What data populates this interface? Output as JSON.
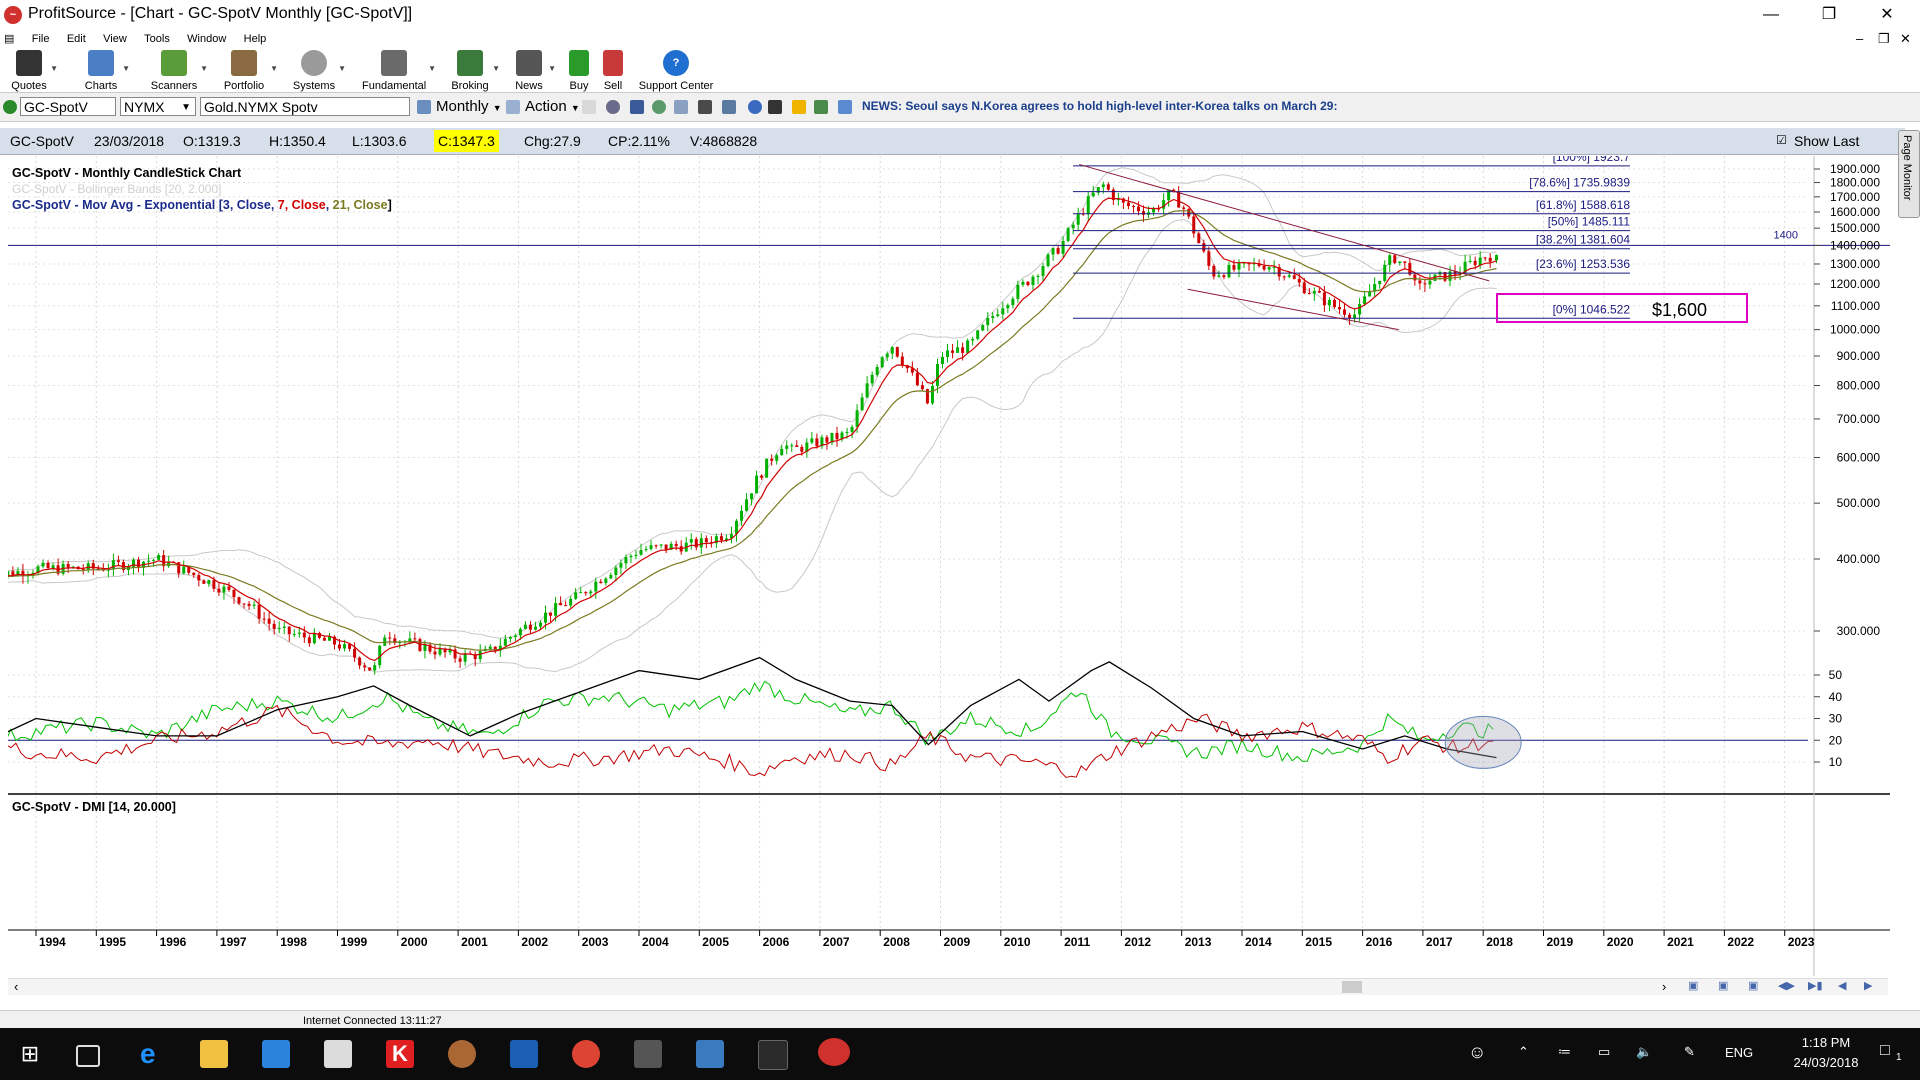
{
  "window": {
    "title": "ProfitSource - [Chart - GC-SpotV Monthly [GC-SpotV]]"
  },
  "menu": [
    "File",
    "Edit",
    "View",
    "Tools",
    "Window",
    "Help"
  ],
  "toolbar": {
    "items": [
      "Quotes",
      "Charts",
      "Scanners",
      "Portfolio",
      "Systems",
      "Fundamental",
      "Broking",
      "News",
      "Buy",
      "Sell",
      "Support Center"
    ]
  },
  "symbol_bar": {
    "symbol": "GC-SpotV",
    "exchange": "NYMX",
    "name": "Gold.NYMX Spotv",
    "period": "Monthly",
    "action": "Action",
    "news": "NEWS: Seoul says N.Korea agrees to hold high-level inter-Korea talks on March 29:"
  },
  "info": {
    "symbol": "GC-SpotV",
    "date": "23/03/2018",
    "open": "O:1319.3",
    "high": "H:1350.4",
    "low": "L:1303.6",
    "close": "C:1347.3",
    "chg": "Chg:27.9",
    "cp": "CP:2.11%",
    "vol": "V:4868828",
    "show_last": "Show Last"
  },
  "side_tab": "Page Monitor",
  "status": {
    "text": "Internet Connected 13:11:27"
  },
  "taskbar": {
    "lang": "ENG",
    "time": "1:18 PM",
    "date": "24/03/2018",
    "notif": "1"
  },
  "colors": {
    "bull": "#00b000",
    "bear": "#d00000",
    "ema3": "#d00000",
    "ema21": "#7a7a22",
    "bollinger": "#c8c8c8",
    "fib": "#1a1a80",
    "trend": "#8b1a3a",
    "plus_di": "#00c000",
    "minus_di": "#c00000",
    "adx": "#000000",
    "highlight": "#ffff00",
    "box": "#e000c0"
  },
  "chart_data": [
    {
      "type": "candlestick",
      "title": "GC-SpotV - Monthly CandleStick Chart",
      "legend": [
        "GC-SpotV - Bollinger Bands [20, 2.000]",
        "GC-SpotV - Mov Avg - Exponential [3, Close, 7, Close, 21, Close]"
      ],
      "ylim": [
        250,
        1960
      ],
      "y_ticks": [
        "300.000",
        "400.000",
        "500.000",
        "600.000",
        "700.000",
        "800.000",
        "900.000",
        "1000.000",
        "1100.000",
        "1200.000",
        "1300.000",
        "1400.000",
        "1500.000",
        "1600.000",
        "1700.000",
        "1800.000",
        "1900.000"
      ],
      "x_ticks": [
        "1994",
        "1995",
        "1996",
        "1997",
        "1998",
        "1999",
        "2000",
        "2001",
        "2002",
        "2003",
        "2004",
        "2005",
        "2006",
        "2007",
        "2008",
        "2009",
        "2010",
        "2011",
        "2012",
        "2013",
        "2014",
        "2015",
        "2016",
        "2017",
        "2018",
        "2019",
        "2020",
        "2021",
        "2022",
        "2023"
      ],
      "close_path": [
        [
          1993.0,
          370
        ],
        [
          1994.0,
          385
        ],
        [
          1995.0,
          385
        ],
        [
          1996.0,
          400
        ],
        [
          1996.5,
          380
        ],
        [
          1997.0,
          360
        ],
        [
          1997.5,
          335
        ],
        [
          1998.0,
          300
        ],
        [
          1999.0,
          285
        ],
        [
          1999.6,
          255
        ],
        [
          1999.8,
          300
        ],
        [
          2000.0,
          290
        ],
        [
          2001.0,
          270
        ],
        [
          2001.5,
          275
        ],
        [
          2002.0,
          300
        ],
        [
          2003.0,
          345
        ],
        [
          2004.0,
          415
        ],
        [
          2005.0,
          425
        ],
        [
          2005.5,
          445
        ],
        [
          2006.0,
          560
        ],
        [
          2006.4,
          640
        ],
        [
          2006.5,
          615
        ],
        [
          2007.0,
          640
        ],
        [
          2007.5,
          660
        ],
        [
          2008.0,
          900
        ],
        [
          2008.2,
          940
        ],
        [
          2008.8,
          740
        ],
        [
          2009.0,
          900
        ],
        [
          2009.5,
          940
        ],
        [
          2010.0,
          1100
        ],
        [
          2010.5,
          1230
        ],
        [
          2011.0,
          1400
        ],
        [
          2011.5,
          1700
        ],
        [
          2011.7,
          1780
        ],
        [
          2012.0,
          1650
        ],
        [
          2012.5,
          1600
        ],
        [
          2012.8,
          1720
        ],
        [
          2013.0,
          1650
        ],
        [
          2013.3,
          1400
        ],
        [
          2013.5,
          1250
        ],
        [
          2014.0,
          1280
        ],
        [
          2014.3,
          1300
        ],
        [
          2014.5,
          1290
        ],
        [
          2015.0,
          1190
        ],
        [
          2015.5,
          1100
        ],
        [
          2015.9,
          1060
        ],
        [
          2016.0,
          1110
        ],
        [
          2016.5,
          1340
        ],
        [
          2016.8,
          1270
        ],
        [
          2016.9,
          1150
        ],
        [
          2017.0,
          1210
        ],
        [
          2017.5,
          1250
        ],
        [
          2018.0,
          1340
        ],
        [
          2018.22,
          1347.3
        ]
      ],
      "current_bar": {
        "open": 1319.3,
        "high": 1350.4,
        "low": 1303.6,
        "close": 1347.3
      },
      "fib_levels": [
        {
          "label": "[100%] 1923.7",
          "value": 1923.7
        },
        {
          "label": "[78.6%] 1735.9839",
          "value": 1735.9839
        },
        {
          "label": "[61.8%] 1588.618",
          "value": 1588.618
        },
        {
          "label": "[50%] 1485.111",
          "value": 1485.111
        },
        {
          "label": "[38.2%] 1381.604",
          "value": 1381.604
        },
        {
          "label": "[23.6%] 1253.536",
          "value": 1253.536
        },
        {
          "label": "[0%] 1046.522",
          "value": 1046.522
        }
      ],
      "horizontal_line": {
        "value": 1400,
        "label": "1400"
      },
      "annotation": "$1,600"
    },
    {
      "type": "line",
      "title": "GC-SpotV - DMI [14, 20.000]",
      "ylim": [
        0,
        60
      ],
      "y_ticks": [
        "10",
        "20",
        "30",
        "40",
        "50"
      ],
      "threshold": 20,
      "series": [
        {
          "values": [
            [
              1993,
              19
            ],
            [
              1994,
              24
            ],
            [
              1995,
              28
            ],
            [
              1996,
              22
            ],
            [
              1997,
              34
            ],
            [
              1998,
              38
            ],
            [
              1999,
              30
            ],
            [
              1999.8,
              40
            ],
            [
              2000.5,
              28
            ],
            [
              2001.5,
              22
            ],
            [
              2002.5,
              38
            ],
            [
              2003.5,
              40
            ],
            [
              2004.5,
              34
            ],
            [
              2005.5,
              38
            ],
            [
              2006,
              46
            ],
            [
              2006.5,
              40
            ],
            [
              2007.5,
              32
            ],
            [
              2008.2,
              36
            ],
            [
              2008.8,
              20
            ],
            [
              2009.5,
              30
            ],
            [
              2010.5,
              24
            ],
            [
              2011.3,
              44
            ],
            [
              2011.8,
              24
            ],
            [
              2012.5,
              20
            ],
            [
              2013.3,
              14
            ],
            [
              2014,
              18
            ],
            [
              2015,
              12
            ],
            [
              2016,
              18
            ],
            [
              2016.4,
              30
            ],
            [
              2017,
              20
            ],
            [
              2017.6,
              26
            ],
            [
              2018.1,
              24
            ],
            [
              2018.22,
              28
            ]
          ]
        },
        {
          "values": [
            [
              1993,
              20
            ],
            [
              1994,
              14
            ],
            [
              1995,
              12
            ],
            [
              1996,
              20
            ],
            [
              1997,
              24
            ],
            [
              1998,
              34
            ],
            [
              1999,
              20
            ],
            [
              1999.8,
              18
            ],
            [
              2000.5,
              20
            ],
            [
              2001.5,
              14
            ],
            [
              2002.5,
              10
            ],
            [
              2003.5,
              12
            ],
            [
              2004.5,
              16
            ],
            [
              2005.5,
              10
            ],
            [
              2006,
              5
            ],
            [
              2006.5,
              12
            ],
            [
              2007.5,
              14
            ],
            [
              2008.2,
              8
            ],
            [
              2008.8,
              22
            ],
            [
              2009.5,
              12
            ],
            [
              2010.5,
              10
            ],
            [
              2011.3,
              5
            ],
            [
              2011.8,
              14
            ],
            [
              2012.5,
              22
            ],
            [
              2013.3,
              30
            ],
            [
              2014,
              22
            ],
            [
              2015,
              26
            ],
            [
              2016,
              20
            ],
            [
              2016.4,
              12
            ],
            [
              2017,
              20
            ],
            [
              2017.6,
              16
            ],
            [
              2018.1,
              20
            ],
            [
              2018.22,
              17
            ]
          ]
        },
        {
          "values": [
            [
              1993,
              17
            ],
            [
              1994,
              30
            ],
            [
              1995,
              26
            ],
            [
              1996,
              22
            ],
            [
              1997,
              22
            ],
            [
              1998,
              34
            ],
            [
              1999,
              40
            ],
            [
              1999.6,
              45
            ],
            [
              2000.2,
              36
            ],
            [
              2001.2,
              22
            ],
            [
              2002,
              32
            ],
            [
              2003,
              42
            ],
            [
              2004,
              52
            ],
            [
              2005,
              48
            ],
            [
              2006,
              58
            ],
            [
              2006.6,
              48
            ],
            [
              2007.5,
              38
            ],
            [
              2008.2,
              36
            ],
            [
              2008.8,
              18
            ],
            [
              2009.5,
              36
            ],
            [
              2010.3,
              48
            ],
            [
              2010.8,
              38
            ],
            [
              2011.5,
              52
            ],
            [
              2011.8,
              56
            ],
            [
              2012.5,
              44
            ],
            [
              2013.2,
              30
            ],
            [
              2014,
              22
            ],
            [
              2015,
              24
            ],
            [
              2016,
              16
            ],
            [
              2016.7,
              22
            ],
            [
              2017.4,
              16
            ],
            [
              2018.22,
              12
            ]
          ]
        }
      ]
    }
  ]
}
